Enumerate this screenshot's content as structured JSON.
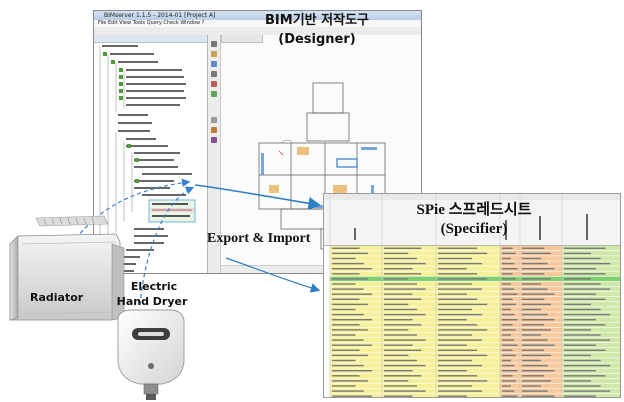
{
  "bim_tool": {
    "title_line1": "BIM기반 저작도구",
    "title_line2": "(Designer)",
    "window_title": "BIMserver 1.1.5 - 2014-01 [Project A]",
    "menu": "File  Edit  View  Tools  Query  Check  Window  ?"
  },
  "spreadsheet": {
    "title_line1": "SPie 스프레드시트",
    "title_line2": "(Specifier)"
  },
  "flow_label": "Export & Import",
  "products": {
    "radiator": "Radiator",
    "dryer_line1": "Electric",
    "dryer_line2": "Hand Dryer"
  },
  "colors": {
    "callout_arrow": "#2f7fc6",
    "dashed_line": "#3a7fd0",
    "highlight_green": "#7fcf6f",
    "cell_yellow": "#f6f09a",
    "cell_orange": "#f6c89c",
    "cell_green": "#cfe8a8"
  }
}
